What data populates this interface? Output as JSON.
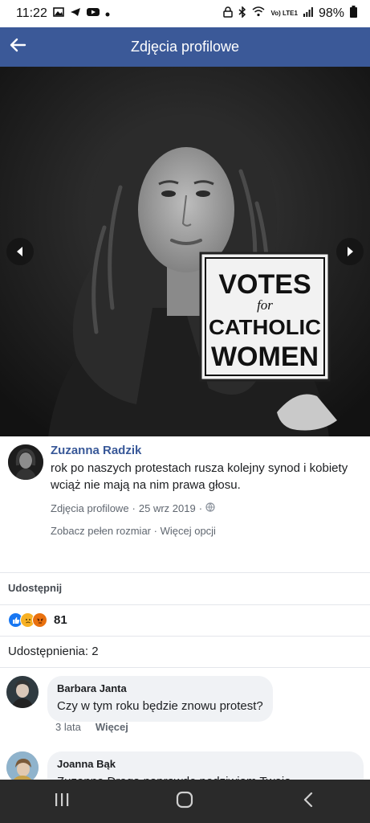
{
  "status_bar": {
    "time": "11:22",
    "battery": "98%",
    "network_label": "Vo) LTE1",
    "left_icons": [
      "gallery-icon",
      "telegram-icon",
      "youtube-icon",
      "dot-icon"
    ],
    "right_icons": [
      "lock-icon",
      "bluetooth-icon",
      "wifi-icon",
      "signal-icon",
      "battery-icon"
    ]
  },
  "app_bar": {
    "title": "Zdjęcia profilowe",
    "back_icon": "arrow-left-icon"
  },
  "photo": {
    "sign_lines": [
      "VOTES",
      "for",
      "CATHOLIC",
      "WOMEN"
    ],
    "prev_icon": "chevron-left-icon",
    "next_icon": "chevron-right-icon"
  },
  "post": {
    "author": "Zuzanna Radzik",
    "text": "rok po naszych protestach rusza kolejny synod i kobiety wciąż nie mają na nim prawa głosu.",
    "album": "Zdjęcia profilowe",
    "date": "25 wrz 2019",
    "separator": "·",
    "privacy_icon": "globe-icon",
    "full_size": "Zobacz pełen rozmiar",
    "more_options": "Więcej opcji"
  },
  "share_label": "Udostępnij",
  "reactions": {
    "count": "81",
    "types": [
      "like",
      "sad",
      "angry"
    ]
  },
  "shares": "Udostępnienia: 2",
  "comments": [
    {
      "author": "Barbara Janta",
      "text": "Czy w tym roku będzie znowu protest?",
      "time": "3 lata",
      "action": "Więcej"
    },
    {
      "author": "Joanna Bąk",
      "text": "Zuzanno Droga naprawdę podziwiam Twoją"
    }
  ],
  "nav_bar": {
    "buttons": [
      "recents-icon",
      "home-icon",
      "back-icon"
    ]
  },
  "colors": {
    "brand": "#3b5998",
    "link": "#385898",
    "navbar": "#2a2a2a"
  }
}
